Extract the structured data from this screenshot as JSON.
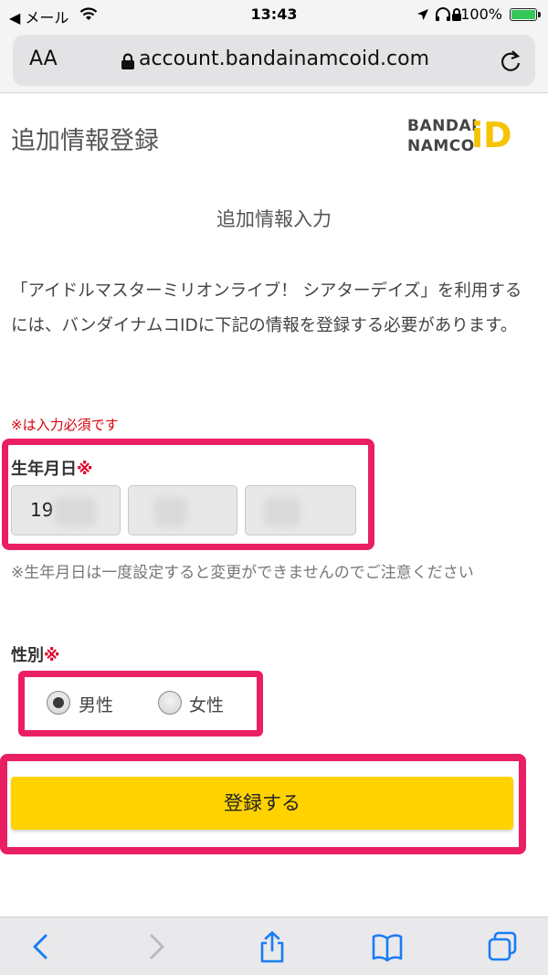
{
  "status_bar": {
    "carrier": "◀ メール",
    "time": "13:43",
    "battery_percent": "100%",
    "battery_level": 1.0
  },
  "browser": {
    "text_size_button": "AA",
    "url": "account.bandainamcoid.com"
  },
  "header": {
    "title": "追加情報登録",
    "logo_line1": "BANDAI",
    "logo_line2": "NAMCO",
    "logo_mark": "iD"
  },
  "form": {
    "heading": "追加情報入力",
    "intro": "「アイドルマスターミリオンライブ！ シアターデイズ」を利用するには、バンダイナムコIDに下記の情報を登録する必要があります。",
    "required_note": "※は入力必須です",
    "birthdate": {
      "label": "生年月日",
      "required_mark": "※",
      "year_value": "19",
      "note": "※生年月日は一度設定すると変更ができませんのでご注意ください"
    },
    "gender": {
      "label": "性別",
      "required_mark": "※",
      "options": [
        "男性",
        "女性"
      ],
      "selected": "男性"
    },
    "submit_label": "登録する"
  },
  "colors": {
    "accent_yellow": "#ffd200",
    "highlight_pink": "#ea1f63",
    "required_red": "#d8000c",
    "ios_blue": "#1a7cf5"
  },
  "toolbar": {
    "icons": [
      "back-icon",
      "forward-icon",
      "share-icon",
      "bookmarks-icon",
      "tabs-icon"
    ]
  }
}
